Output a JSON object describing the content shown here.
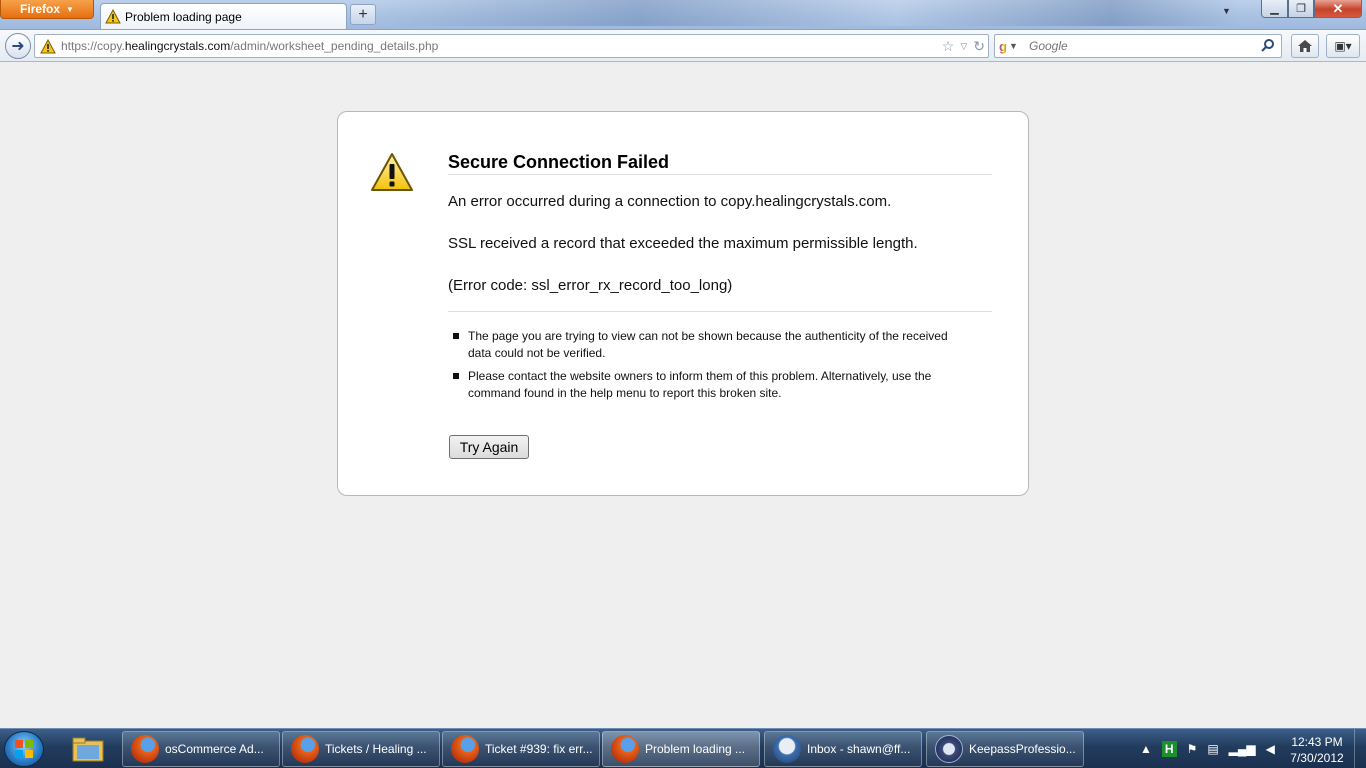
{
  "browser": {
    "menu_button_label": "Firefox",
    "tab_title": "Problem loading page",
    "new_tab_label": "+",
    "url_host_prefix": "https://copy.",
    "url_domain": "healingcrystals.com",
    "url_path": "/admin/worksheet_pending_details.php",
    "search_placeholder": "Google"
  },
  "error_page": {
    "title": "Secure Connection Failed",
    "message": "An error occurred during a connection to copy.healingcrystals.com.",
    "detail": "SSL received a record that exceeded the maximum permissible length.",
    "error_code": "(Error code: ssl_error_rx_record_too_long)",
    "bullets": [
      "The page you are trying to view can not be shown because the authenticity of the received data could not be verified.",
      "Please contact the website owners to inform them of this problem. Alternatively, use the command found in the help menu to report this broken site."
    ],
    "try_again_label": "Try Again"
  },
  "taskbar": {
    "items": [
      {
        "label": "osCommerce Ad...",
        "icon": "firefox-icon"
      },
      {
        "label": "Tickets / Healing ...",
        "icon": "firefox-icon"
      },
      {
        "label": "Ticket #939: fix err...",
        "icon": "firefox-icon"
      },
      {
        "label": "Problem loading ...",
        "icon": "firefox-icon"
      },
      {
        "label": "Inbox - shawn@ff...",
        "icon": "thunderbird-icon"
      },
      {
        "label": "KeepassProfessio...",
        "icon": "keepass-icon"
      }
    ],
    "tray_letter": "H",
    "clock_time": "12:43 PM",
    "clock_date": "7/30/2012"
  }
}
